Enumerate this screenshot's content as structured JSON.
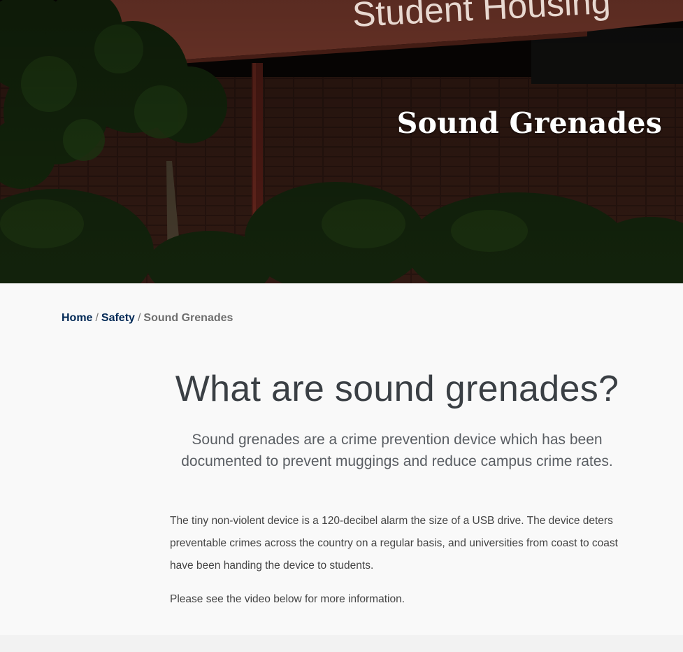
{
  "hero": {
    "title": "Sound Grenades",
    "awning_text": "Student Housing"
  },
  "breadcrumb": {
    "items": [
      {
        "label": "Home"
      },
      {
        "label": "Safety"
      }
    ],
    "separator": "/",
    "current": "Sound Grenades"
  },
  "main": {
    "heading": "What are sound grenades?",
    "lead_line1": "Sound grenades are a crime prevention device which has been",
    "lead_line2": "documented to prevent muggings and reduce campus crime rates.",
    "paragraph1": "The tiny non-violent device is a 120-decibel alarm the size of a USB drive. The device deters preventable crimes across the country on a regular basis, and universities from coast to coast have been handing the device to students.",
    "paragraph2": "Please see the video below for more information."
  },
  "colors": {
    "link": "#002855",
    "heading": "#3a3f44",
    "awning": "#c8604a"
  }
}
